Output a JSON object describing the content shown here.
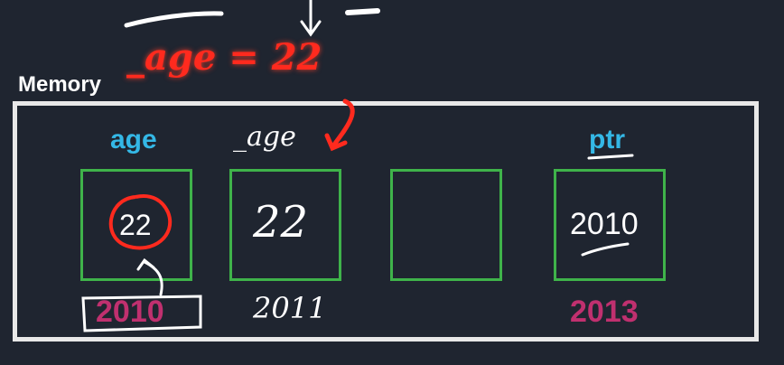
{
  "memory_label": "Memory",
  "annotation": {
    "assignment": "_age = 22"
  },
  "cells": [
    {
      "label": "age",
      "value": "22",
      "address": "2010"
    },
    {
      "label": "_age",
      "value": "22",
      "address": "2011"
    },
    {
      "label": "",
      "value": "",
      "address": ""
    },
    {
      "label": "ptr",
      "value": "2010",
      "address": "2013"
    }
  ],
  "colors": {
    "background": "#1f2530",
    "label_blue": "#34b8e6",
    "cell_border_green": "#3fb34a",
    "address_magenta": "#c0306f",
    "annotation_red": "#ff2a1e"
  }
}
